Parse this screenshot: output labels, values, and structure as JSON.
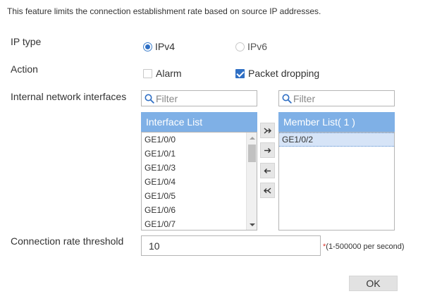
{
  "description": "This feature limits the connection establishment rate based on source IP addresses.",
  "ip_type": {
    "label": "IP type",
    "options": [
      {
        "label": "IPv4",
        "selected": true
      },
      {
        "label": "IPv6",
        "selected": false
      }
    ]
  },
  "action": {
    "label": "Action",
    "options": [
      {
        "label": "Alarm",
        "checked": false
      },
      {
        "label": "Packet dropping",
        "checked": true
      }
    ]
  },
  "interfaces": {
    "label": "Internal network interfaces",
    "filter_placeholder": "Filter",
    "available": {
      "header": "Interface List",
      "items": [
        "GE1/0/0",
        "GE1/0/1",
        "GE1/0/3",
        "GE1/0/4",
        "GE1/0/5",
        "GE1/0/6",
        "GE1/0/7"
      ]
    },
    "members": {
      "header": "Member List( 1 )",
      "items": [
        "GE1/0/2"
      ]
    },
    "move_buttons": [
      "move-all-right-icon",
      "move-right-icon",
      "move-left-icon",
      "move-all-left-icon"
    ]
  },
  "threshold": {
    "label": "Connection rate threshold",
    "value": "10",
    "required_mark": "*",
    "hint": "(1-500000 per second)"
  },
  "ok_label": "OK",
  "colors": {
    "accent": "#2f6fc4",
    "list_header": "#7fb0e6",
    "selected_row": "#d6e4f7",
    "required": "#d9342b"
  }
}
